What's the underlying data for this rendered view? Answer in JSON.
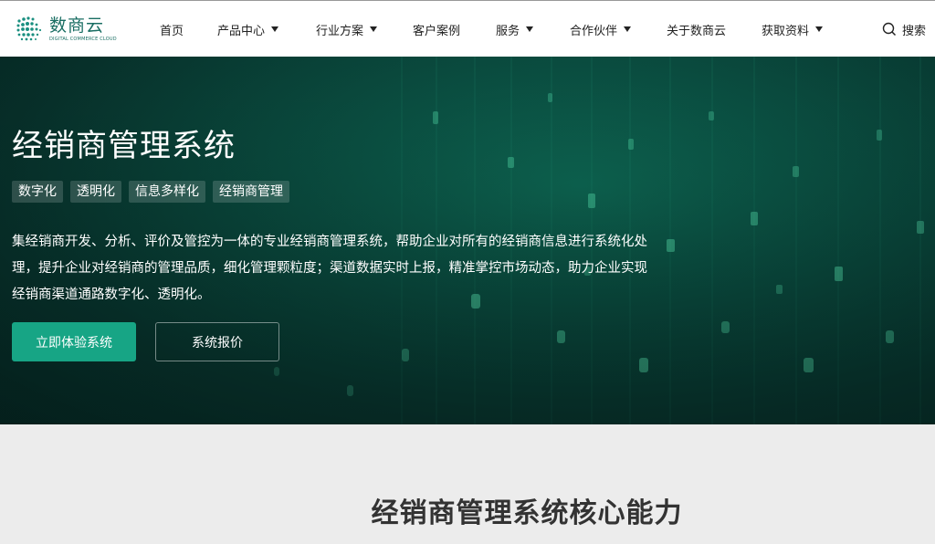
{
  "header": {
    "logo": {
      "name": "数商云",
      "subtitle": "DIGITAL COMMERCE CLOUD"
    },
    "nav": [
      {
        "label": "首页",
        "dropdown": false
      },
      {
        "label": "产品中心",
        "dropdown": true
      },
      {
        "label": "行业方案",
        "dropdown": true
      },
      {
        "label": "客户案例",
        "dropdown": false
      },
      {
        "label": "服务",
        "dropdown": true
      },
      {
        "label": "合作伙伴",
        "dropdown": true
      },
      {
        "label": "关于数商云",
        "dropdown": false
      },
      {
        "label": "获取资料",
        "dropdown": true
      }
    ],
    "search_label": "搜索"
  },
  "hero": {
    "title": "经销商管理系统",
    "tags": [
      "数字化",
      "透明化",
      "信息多样化",
      "经销商管理"
    ],
    "description_lines": [
      "集经销商开发、分析、评价及管控为一体的专业经销商管理系统，帮助企业对所有的经销商信息进行系统化处",
      "理，提升企业对经销商的管理品质，细化管理颗粒度；渠道数据实时上报，精准掌控市场动态，助力企业实现",
      "经销商渠道通路数字化、透明化。"
    ],
    "primary_button": "立即体验系统",
    "secondary_button": "系统报价"
  },
  "section": {
    "title": "经销商管理系统核心能力"
  },
  "colors": {
    "brand": "#1a6e63",
    "accent": "#17a585",
    "hero_dark": "#07302a"
  }
}
